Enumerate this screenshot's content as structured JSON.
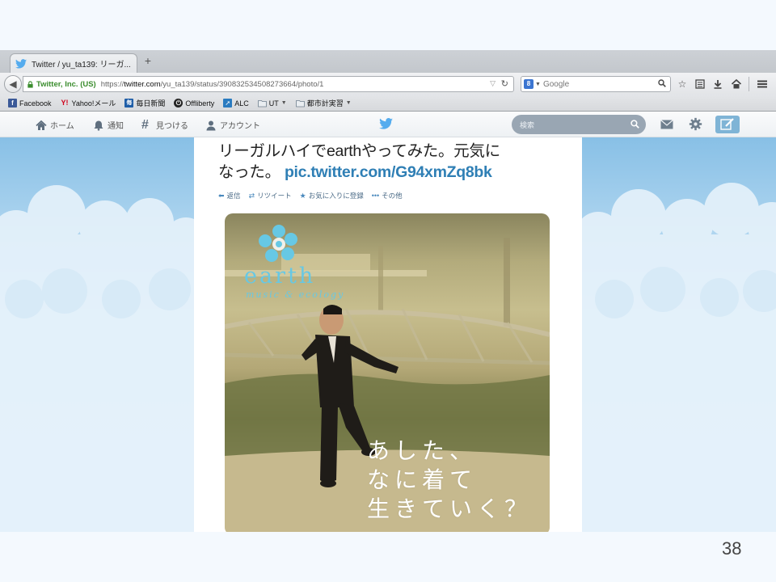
{
  "browser": {
    "tab_title": "Twitter / yu_ta139: リーガ...",
    "new_tab_label": "+",
    "identity": "Twitter, Inc. (US)",
    "url_prefix": "https://",
    "url_host": "twitter.com",
    "url_path": "/yu_ta139/status/390832534508273664/photo/1",
    "search_engine_label": "8",
    "search_placeholder": "Google",
    "bookmarks": [
      {
        "label": "Facebook",
        "icon": "facebook-icon",
        "color": "#3b5998"
      },
      {
        "label": "Yahoo!メール",
        "icon": "yahoo-icon",
        "color": "#d0021b"
      },
      {
        "label": "毎日新聞",
        "icon": "mainichi-icon",
        "color": "#1f5ea8"
      },
      {
        "label": "Offliberty",
        "icon": "power-icon",
        "color": "#222222"
      },
      {
        "label": "ALC",
        "icon": "alc-icon",
        "color": "#2a7bc0"
      },
      {
        "label": "UT",
        "icon": "folder-icon",
        "color": "#7a8a99"
      },
      {
        "label": "都市計実習",
        "icon": "folder-icon",
        "color": "#7a8a99"
      }
    ]
  },
  "twitter": {
    "nav": {
      "home": "ホーム",
      "notifications": "通知",
      "discover": "見つける",
      "account": "アカウント"
    },
    "search_placeholder": "検索",
    "accent_color": "#55acee"
  },
  "tweet": {
    "text_line1": "リーガルハイでearthやってみた。元気に",
    "text_line2_prefix": "なった。",
    "link": "pic.twitter.com/G94xmZq8bk",
    "actions": {
      "reply": "返信",
      "retweet": "リツイート",
      "favorite": "お気に入りに登録",
      "more": "その他"
    }
  },
  "photo": {
    "brand": "earth",
    "brand_sub": "music & ecology",
    "copy_line1": "あした、",
    "copy_line2": "なに着て",
    "copy_line3": "生きていく？"
  },
  "slide": {
    "page_number": "38"
  }
}
